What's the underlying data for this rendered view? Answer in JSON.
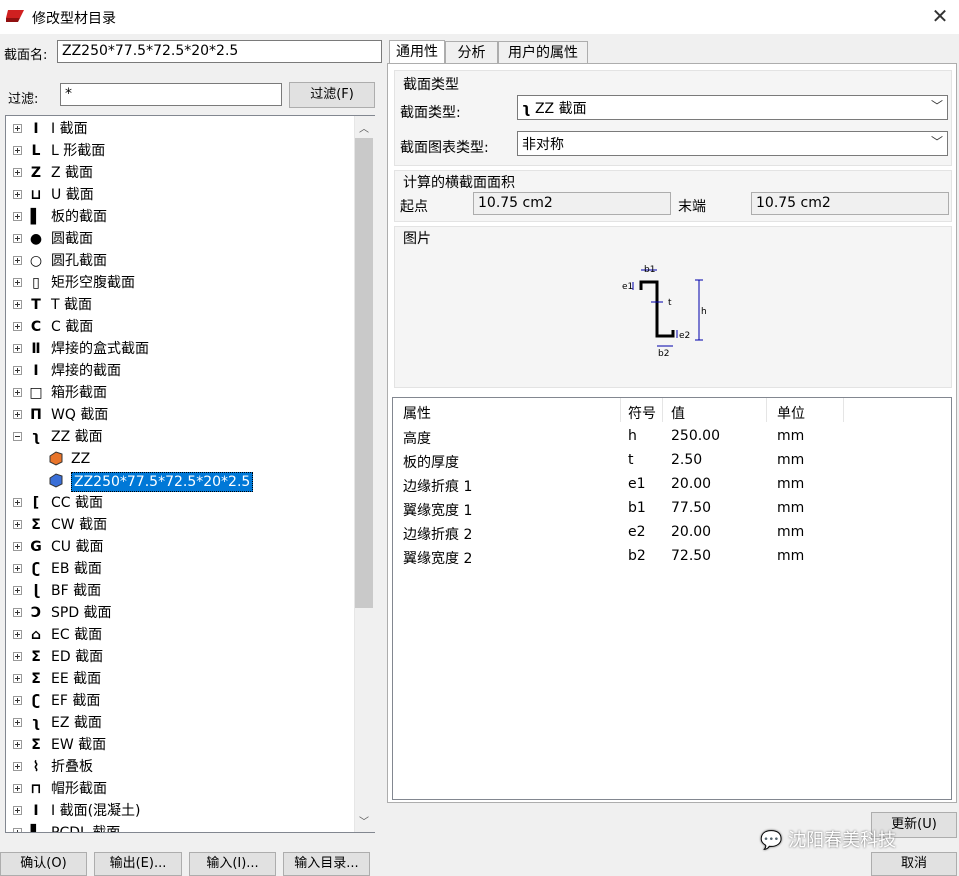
{
  "window": {
    "title": "修改型材目录"
  },
  "section_name": {
    "label": "截面名:",
    "value": "ZZ250*77.5*72.5*20*2.5"
  },
  "filter": {
    "label": "过滤:",
    "value": "*",
    "button": "过滤(F)"
  },
  "tree": {
    "items": [
      {
        "icon": "I-icon",
        "glyph": "I",
        "label": "I 截面"
      },
      {
        "icon": "L-icon",
        "glyph": "L",
        "label": "L 形截面"
      },
      {
        "icon": "Z-icon",
        "glyph": "Z",
        "label": "Z 截面"
      },
      {
        "icon": "U-icon",
        "glyph": "⊔",
        "label": "U 截面"
      },
      {
        "icon": "plate-icon",
        "glyph": "▌",
        "label": "板的截面"
      },
      {
        "icon": "circle-icon",
        "glyph": "●",
        "label": "圆截面"
      },
      {
        "icon": "tube-icon",
        "glyph": "○",
        "label": "圆孔截面"
      },
      {
        "icon": "rect-hollow-icon",
        "glyph": "▯",
        "label": "矩形空腹截面"
      },
      {
        "icon": "T-icon",
        "glyph": "T",
        "label": "T 截面"
      },
      {
        "icon": "C-icon",
        "glyph": "C",
        "label": "C 截面"
      },
      {
        "icon": "welded-box-icon",
        "glyph": "Ⅱ",
        "label": "焊接的盒式截面"
      },
      {
        "icon": "welded-icon",
        "glyph": "I",
        "label": "焊接的截面"
      },
      {
        "icon": "box-icon",
        "glyph": "□",
        "label": "箱形截面"
      },
      {
        "icon": "WQ-icon",
        "glyph": "Π",
        "label": "WQ 截面"
      },
      {
        "icon": "ZZ-icon",
        "glyph": "ʅ",
        "label": "ZZ 截面"
      },
      {
        "icon": "CC-icon",
        "glyph": "[",
        "label": "CC 截面"
      },
      {
        "icon": "CW-icon",
        "glyph": "Σ",
        "label": "CW 截面"
      },
      {
        "icon": "CU-icon",
        "glyph": "G",
        "label": "CU 截面"
      },
      {
        "icon": "EB-icon",
        "glyph": "ʗ",
        "label": "EB 截面"
      },
      {
        "icon": "BF-icon",
        "glyph": "ɭ",
        "label": "BF 截面"
      },
      {
        "icon": "SPD-icon",
        "glyph": "Ɔ",
        "label": "SPD 截面"
      },
      {
        "icon": "EC-icon",
        "glyph": "⌂",
        "label": "EC 截面"
      },
      {
        "icon": "ED-icon",
        "glyph": "Σ",
        "label": "ED 截面"
      },
      {
        "icon": "EE-icon",
        "glyph": "Σ",
        "label": "EE 截面"
      },
      {
        "icon": "EF-icon",
        "glyph": "ʗ",
        "label": "EF 截面"
      },
      {
        "icon": "EZ-icon",
        "glyph": "ʅ",
        "label": "EZ 截面"
      },
      {
        "icon": "EW-icon",
        "glyph": "Σ",
        "label": "EW 截面"
      },
      {
        "icon": "folded-plate-icon",
        "glyph": "⌇",
        "label": "折叠板"
      },
      {
        "icon": "hat-icon",
        "glyph": "⊓",
        "label": "帽形截面"
      },
      {
        "icon": "I-concrete-icon",
        "glyph": "I",
        "label": "I 截面(混凝土)"
      },
      {
        "icon": "PCDL-icon",
        "glyph": "▙",
        "label": "PCDL 截面"
      }
    ],
    "children": [
      {
        "icon": "profile-orange-icon",
        "label": "ZZ"
      },
      {
        "icon": "profile-blue-icon",
        "label": "ZZ250*77.5*72.5*20*2.5"
      }
    ]
  },
  "tabs": [
    {
      "label": "通用性"
    },
    {
      "label": "分析"
    },
    {
      "label": "用户的属性"
    }
  ],
  "section_type": {
    "group_title": "截面类型",
    "type_label": "截面类型:",
    "type_value": "ZZ 截面",
    "chart_type_label": "截面图表类型:",
    "chart_type_value": "非对称"
  },
  "area": {
    "group_title": "计算的横截面面积",
    "start_label": "起点",
    "start_value": "10.75 cm2",
    "end_label": "末端",
    "end_value": "10.75 cm2"
  },
  "picture": {
    "group_title": "图片",
    "dims": {
      "b1": "b1",
      "e1": "e1",
      "t": "t",
      "h": "h",
      "e2": "e2",
      "b2": "b2"
    }
  },
  "properties": {
    "headers": {
      "name": "属性",
      "symbol": "符号",
      "value": "值",
      "unit": "单位"
    },
    "rows": [
      {
        "name": "高度",
        "symbol": "h",
        "value": "250.00",
        "unit": "mm"
      },
      {
        "name": "板的厚度",
        "symbol": "t",
        "value": "2.50",
        "unit": "mm"
      },
      {
        "name": "边缘折痕 1",
        "symbol": "e1",
        "value": "20.00",
        "unit": "mm"
      },
      {
        "name": "翼缘宽度 1",
        "symbol": "b1",
        "value": "77.50",
        "unit": "mm"
      },
      {
        "name": "边缘折痕 2",
        "symbol": "e2",
        "value": "20.00",
        "unit": "mm"
      },
      {
        "name": "翼缘宽度 2",
        "symbol": "b2",
        "value": "72.50",
        "unit": "mm"
      }
    ]
  },
  "buttons": {
    "ok": "确认(O)",
    "export": "输出(E)...",
    "import": "输入(I)...",
    "import_catalog": "输入目录...",
    "update": "更新(U)",
    "cancel": "取消"
  },
  "watermark": "沈阳春美科技"
}
